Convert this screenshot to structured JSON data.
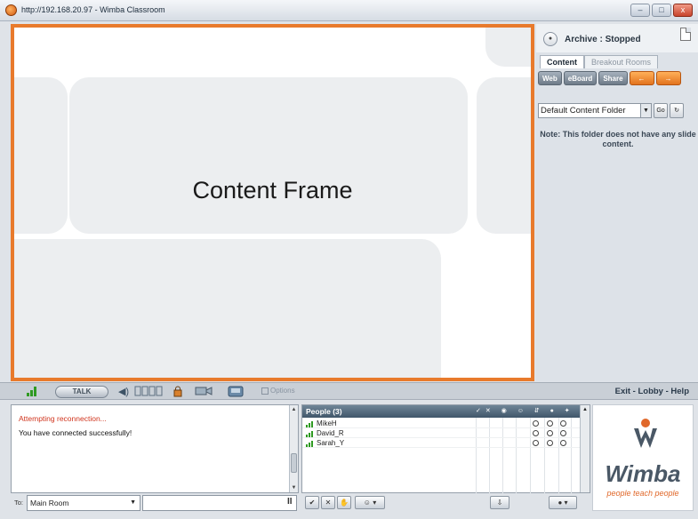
{
  "window": {
    "title": "http://192.168.20.97 - Wimba Classroom",
    "min": "–",
    "max": "□",
    "close": "x"
  },
  "content_frame": {
    "label": "Content Frame"
  },
  "archive": {
    "status": "Archive : Stopped",
    "record_glyph": "●"
  },
  "tabs": [
    {
      "label": "Content",
      "active": true
    },
    {
      "label": "Breakout Rooms",
      "active": false
    }
  ],
  "tools": {
    "web": "Web",
    "eboard": "eBoard",
    "share": "Share",
    "prev": "←",
    "next": "→"
  },
  "folder": {
    "selected": "Default Content Folder",
    "arrow": "▼",
    "go": "Go",
    "refresh": "↻"
  },
  "note": "Note: This folder does not have any slide content.",
  "controls": {
    "talk": "TALK",
    "speaker_glyph": "◀)",
    "options": "Options",
    "exit_links": "Exit - Lobby - Help"
  },
  "chat": {
    "messages": [
      "Attempting reconnection...",
      "You have connected successfully!"
    ],
    "to_label": "To:",
    "room": "Main Room",
    "room_arrow": "▼",
    "pause": "II"
  },
  "people": {
    "title": "People (3)",
    "header_icons": "✓✕ ◉ ☺ ⇵ ● ✦",
    "members": [
      "MikeH",
      "David_R",
      "Sarah_Y"
    ]
  },
  "people_tools": {
    "check": "✔",
    "cross": "✕",
    "hand": "✋",
    "status": "☺ ▾",
    "dl": "⇩",
    "circle": "● ▾"
  },
  "logo": {
    "wordmark": "Wimba",
    "tagline": "people teach people"
  },
  "colors": {
    "frame_border": "#e87a2c",
    "accent_orange": "#e2731e",
    "signal_green": "#2f9a22"
  }
}
